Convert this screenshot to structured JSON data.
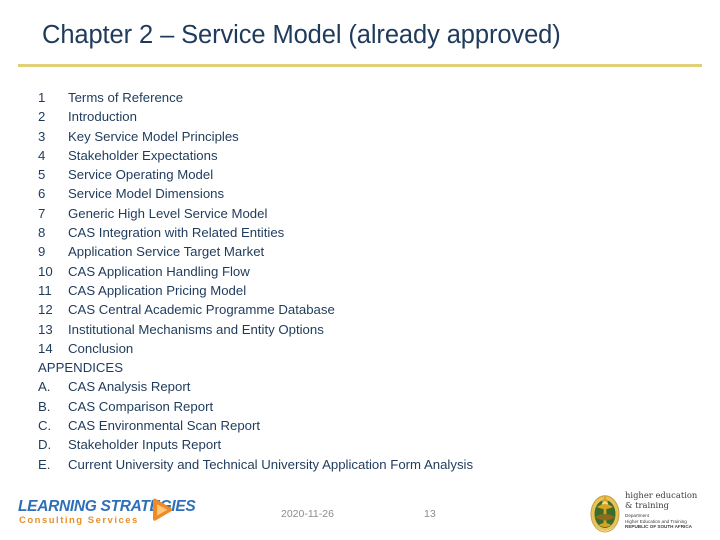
{
  "slide": {
    "title": "Chapter 2 – Service Model (already approved)",
    "accent_rule_color": "#e0d07a",
    "title_color": "#1f3b5c",
    "background_color": "#ffffff"
  },
  "contents": [
    {
      "marker": "1",
      "label": "Terms of Reference"
    },
    {
      "marker": "2",
      "label": "Introduction"
    },
    {
      "marker": "3",
      "label": "Key Service Model Principles"
    },
    {
      "marker": "4",
      "label": "Stakeholder Expectations"
    },
    {
      "marker": "5",
      "label": "Service Operating Model"
    },
    {
      "marker": "6",
      "label": "Service Model Dimensions"
    },
    {
      "marker": "7",
      "label": "Generic High Level Service Model"
    },
    {
      "marker": "8",
      "label": "CAS Integration with Related Entities"
    },
    {
      "marker": "9",
      "label": "Application Service Target Market"
    },
    {
      "marker": "10",
      "label": "CAS Application Handling Flow"
    },
    {
      "marker": "11",
      "label": "CAS Application Pricing Model"
    },
    {
      "marker": "12",
      "label": "CAS Central Academic Programme Database"
    },
    {
      "marker": "13",
      "label": "Institutional Mechanisms and Entity Options"
    },
    {
      "marker": "14",
      "label": "Conclusion"
    },
    {
      "marker": "APPENDICES",
      "label": "",
      "heading": true
    },
    {
      "marker": "A.",
      "label": "CAS Analysis Report"
    },
    {
      "marker": "B.",
      "label": "CAS Comparison Report"
    },
    {
      "marker": "C.",
      "label": "CAS Environmental Scan Report"
    },
    {
      "marker": "D.",
      "label": "Stakeholder Inputs  Report"
    },
    {
      "marker": "E.",
      "label": "Current University and Technical University Application Form Analysis"
    }
  ],
  "footer": {
    "date": "2020-11-26",
    "page_number": "13",
    "text_color": "#8c8c8c"
  },
  "left_logo": {
    "name": "LEARNING STRATEGIES",
    "tagline": "Consulting Services",
    "name_color": "#2e6fb7",
    "tagline_color": "#e8912a",
    "mark_color": "#f08a24",
    "mark_icon": "play-triangle-icon"
  },
  "right_logo": {
    "title_line_1": "higher education",
    "title_line_2": "& training",
    "sub_line_1": "Department",
    "sub_line_2": "Higher Education and Training",
    "sub_line_3": "REPUBLIC OF SOUTH AFRICA",
    "emblem_icon": "south-africa-coat-of-arms-icon",
    "emblem_gold": "#d9a521",
    "emblem_green": "#3f6b2a"
  }
}
